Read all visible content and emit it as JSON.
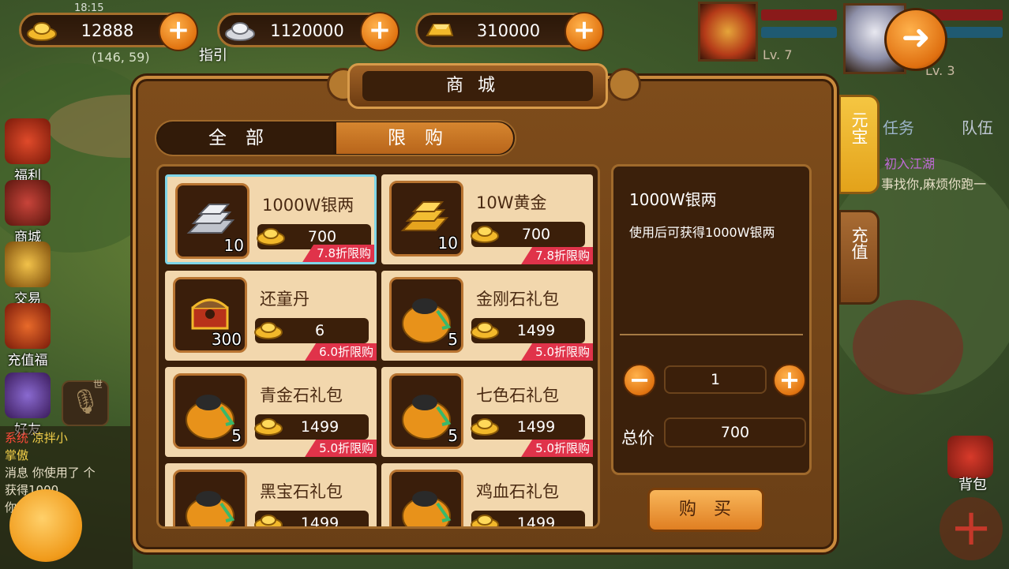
{
  "status": {
    "time": "18:15",
    "coords": "(146, 59)",
    "guide": "指引"
  },
  "currency": [
    {
      "name": "gold-ingot",
      "value": "12888"
    },
    {
      "name": "silver-ingot",
      "value": "1120000"
    },
    {
      "name": "gold-bar",
      "value": "310000"
    }
  ],
  "portraits": [
    {
      "level": "Lv. 7"
    },
    {
      "level": "Lv. 3"
    }
  ],
  "side_menu": [
    {
      "label": "福利",
      "icon": "gift-icon"
    },
    {
      "label": "商城",
      "icon": "mall-icon"
    },
    {
      "label": "交易",
      "icon": "trade-icon"
    },
    {
      "label": "充值福利",
      "icon": "recharge-gift-icon"
    },
    {
      "label": "好友",
      "icon": "friends-icon"
    }
  ],
  "mic": {
    "badge": "世"
  },
  "chat": [
    {
      "tag": "系统",
      "name": "凉拌小",
      "text": "掌傲"
    },
    {
      "tag": "消息",
      "text": "你使用了 个"
    },
    {
      "tag": "",
      "text": "获得1000"
    },
    {
      "tag": "",
      "text": "你使了"
    }
  ],
  "right_tabs": {
    "yuanbao": "元宝",
    "recharge": "充值"
  },
  "quest": {
    "task_tab": "任务",
    "team_tab": "队伍",
    "title": "初入江湖",
    "desc": "事找你,麻烦你跑一"
  },
  "bag_label": "背包",
  "shop": {
    "title": "商城",
    "tabs": [
      {
        "label": "全部",
        "active": false
      },
      {
        "label": "限购",
        "active": true
      }
    ],
    "items": [
      {
        "name": "1000W银两",
        "qty": "10",
        "price": "700",
        "discount": "7.8折限购",
        "icon": "silver-ingots-icon"
      },
      {
        "name": "10W黄金",
        "qty": "10",
        "price": "700",
        "discount": "7.8折限购",
        "icon": "gold-bars-icon"
      },
      {
        "name": "还童丹",
        "qty": "300",
        "price": "6",
        "discount": "6.0折限购",
        "icon": "treasure-chest-icon"
      },
      {
        "name": "金刚石礼包",
        "qty": "5",
        "price": "1499",
        "discount": "5.0折限购",
        "icon": "gift-bag-icon"
      },
      {
        "name": "青金石礼包",
        "qty": "5",
        "price": "1499",
        "discount": "5.0折限购",
        "icon": "gift-bag-icon"
      },
      {
        "name": "七色石礼包",
        "qty": "5",
        "price": "1499",
        "discount": "5.0折限购",
        "icon": "gift-bag-icon"
      },
      {
        "name": "黑宝石礼包",
        "qty": "",
        "price": "1499",
        "discount": "",
        "icon": "gift-bag-icon"
      },
      {
        "name": "鸡血石礼包",
        "qty": "",
        "price": "1499",
        "discount": "",
        "icon": "gift-bag-icon"
      }
    ],
    "detail": {
      "name": "1000W银两",
      "desc": "使用后可获得1000W银两",
      "quantity": "1",
      "total_label": "总价",
      "total": "700"
    },
    "buy_label": "购买"
  },
  "colors": {
    "accent": "#e17411",
    "discount": "#e0334a",
    "item_bg": "#f2d7ad",
    "selected_border": "#7fd6e8"
  }
}
